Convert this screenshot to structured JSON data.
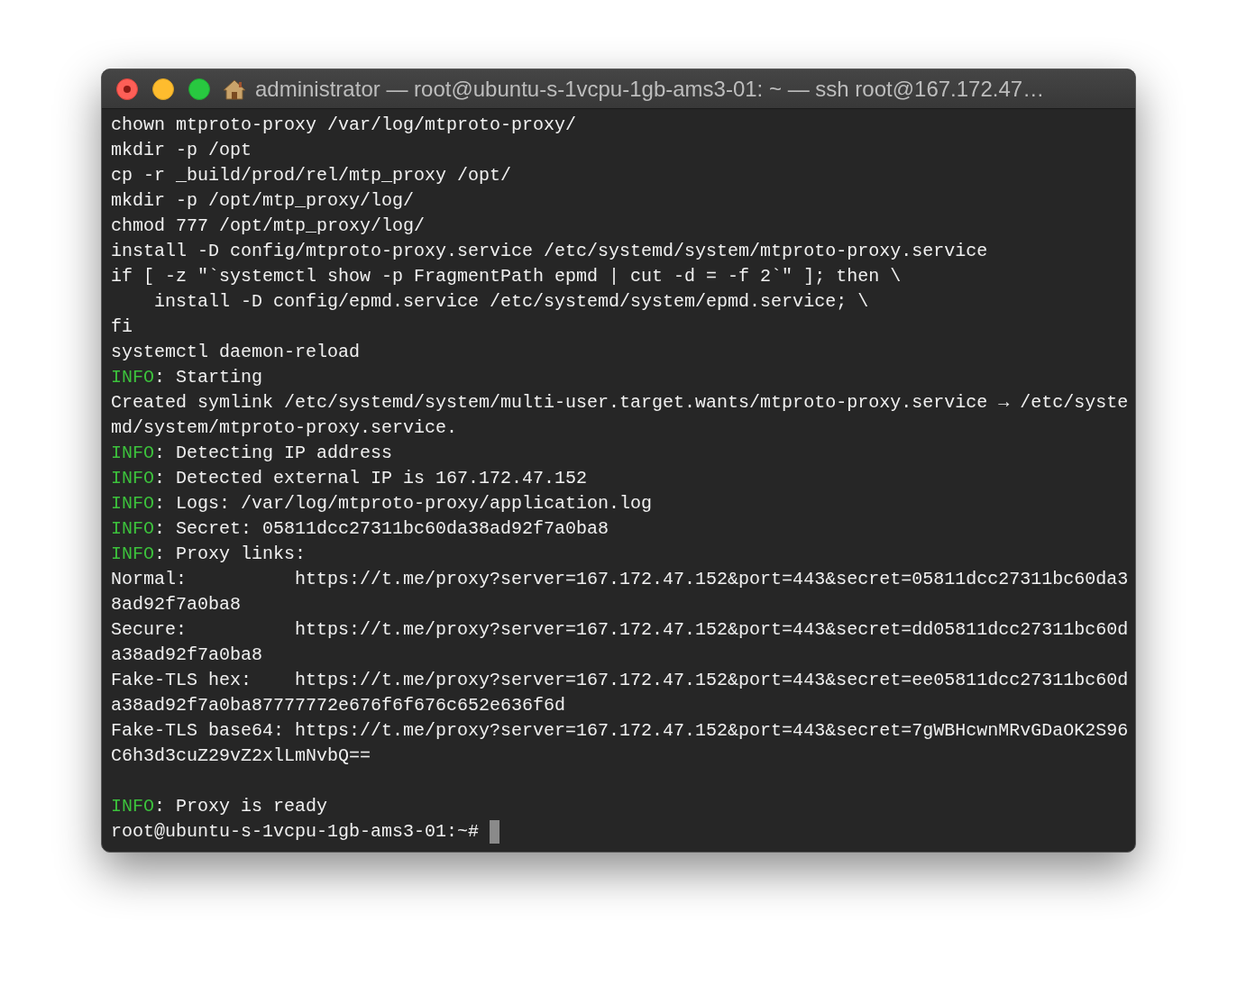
{
  "window": {
    "title": "administrator — root@ubuntu-s-1vcpu-1gb-ams3-01: ~ — ssh root@167.172.47…"
  },
  "lines": [
    {
      "kind": "plain",
      "text": "chown mtproto-proxy /var/log/mtproto-proxy/"
    },
    {
      "kind": "plain",
      "text": "mkdir -p /opt"
    },
    {
      "kind": "plain",
      "text": "cp -r _build/prod/rel/mtp_proxy /opt/"
    },
    {
      "kind": "plain",
      "text": "mkdir -p /opt/mtp_proxy/log/"
    },
    {
      "kind": "plain",
      "text": "chmod 777 /opt/mtp_proxy/log/"
    },
    {
      "kind": "plain",
      "text": "install -D config/mtproto-proxy.service /etc/systemd/system/mtproto-proxy.service"
    },
    {
      "kind": "plain",
      "text": "if [ -z \"`systemctl show -p FragmentPath epmd | cut -d = -f 2`\" ]; then \\"
    },
    {
      "kind": "plain",
      "text": "    install -D config/epmd.service /etc/systemd/system/epmd.service; \\"
    },
    {
      "kind": "plain",
      "text": "fi"
    },
    {
      "kind": "plain",
      "text": "systemctl daemon-reload"
    },
    {
      "kind": "info",
      "tag": "INFO",
      "text": ": Starting"
    },
    {
      "kind": "plain",
      "text": "Created symlink /etc/systemd/system/multi-user.target.wants/mtproto-proxy.service → /etc/syste"
    },
    {
      "kind": "plain",
      "text": "md/system/mtproto-proxy.service."
    },
    {
      "kind": "info",
      "tag": "INFO",
      "text": ": Detecting IP address"
    },
    {
      "kind": "info",
      "tag": "INFO",
      "text": ": Detected external IP is 167.172.47.152"
    },
    {
      "kind": "info",
      "tag": "INFO",
      "text": ": Logs: /var/log/mtproto-proxy/application.log"
    },
    {
      "kind": "info",
      "tag": "INFO",
      "text": ": Secret: 05811dcc27311bc60da38ad92f7a0ba8"
    },
    {
      "kind": "info",
      "tag": "INFO",
      "text": ": Proxy links:"
    },
    {
      "kind": "plain",
      "text": "Normal:          https://t.me/proxy?server=167.172.47.152&port=443&secret=05811dcc27311bc60da3"
    },
    {
      "kind": "plain",
      "text": "8ad92f7a0ba8"
    },
    {
      "kind": "plain",
      "text": "Secure:          https://t.me/proxy?server=167.172.47.152&port=443&secret=dd05811dcc27311bc60d"
    },
    {
      "kind": "plain",
      "text": "a38ad92f7a0ba8"
    },
    {
      "kind": "plain",
      "text": "Fake-TLS hex:    https://t.me/proxy?server=167.172.47.152&port=443&secret=ee05811dcc27311bc60d"
    },
    {
      "kind": "plain",
      "text": "a38ad92f7a0ba87777772e676f6f676c652e636f6d"
    },
    {
      "kind": "plain",
      "text": "Fake-TLS base64: https://t.me/proxy?server=167.172.47.152&port=443&secret=7gWBHcwnMRvGDaOK2S96"
    },
    {
      "kind": "plain",
      "text": "C6h3d3cuZ29vZ2xlLmNvbQ=="
    },
    {
      "kind": "blank"
    },
    {
      "kind": "info",
      "tag": "INFO",
      "text": ": Proxy is ready"
    },
    {
      "kind": "prompt",
      "text": "root@ubuntu-s-1vcpu-1gb-ams3-01:~#"
    }
  ]
}
